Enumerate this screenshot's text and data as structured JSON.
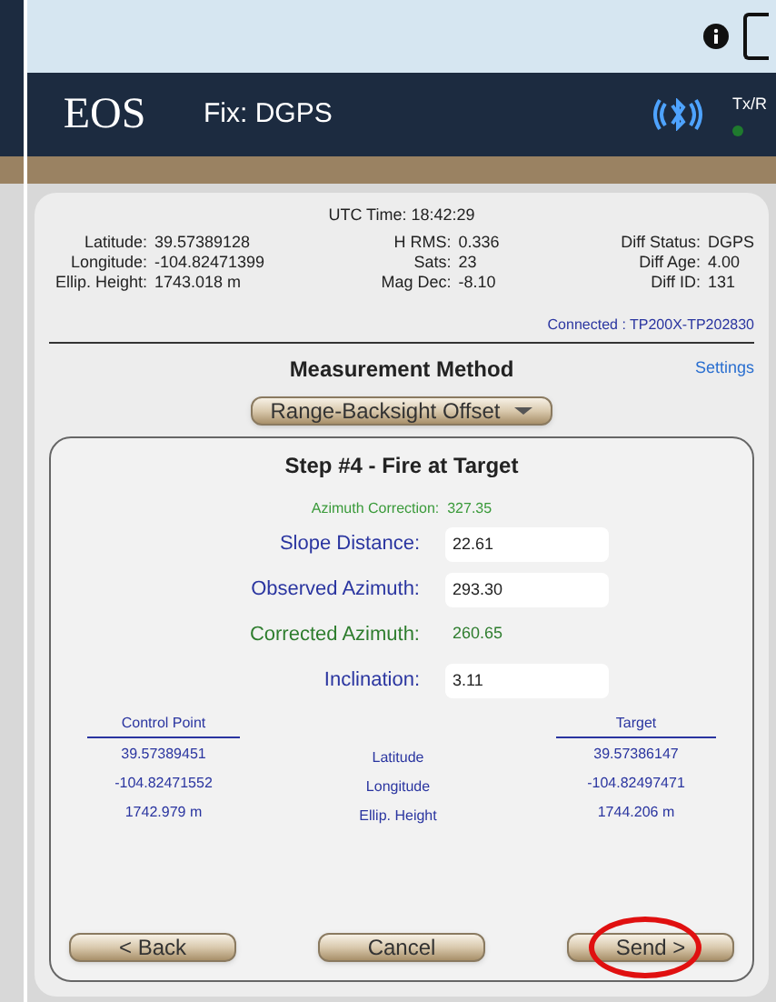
{
  "header": {
    "fix": "Fix: DGPS",
    "txrx": "Tx/R",
    "logo": "EOS"
  },
  "status": {
    "utc": "UTC Time: 18:42:29",
    "col1": [
      {
        "label": "Latitude:",
        "value": "39.57389128"
      },
      {
        "label": "Longitude:",
        "value": "-104.82471399"
      },
      {
        "label": "Ellip. Height:",
        "value": "1743.018 m"
      }
    ],
    "col2": [
      {
        "label": "H RMS:",
        "value": "0.336"
      },
      {
        "label": "Sats:",
        "value": "23"
      },
      {
        "label": "Mag Dec:",
        "value": "-8.10"
      }
    ],
    "col3": [
      {
        "label": "Diff Status:",
        "value": "DGPS"
      },
      {
        "label": "Diff Age:",
        "value": "4.00"
      },
      {
        "label": "Diff ID:",
        "value": "131"
      }
    ],
    "connected": "Connected : TP200X-TP202830"
  },
  "method": {
    "title": "Measurement Method",
    "settings": "Settings",
    "dropdown": "Range-Backsight Offset"
  },
  "step": {
    "title": "Step #4 - Fire at Target",
    "correction": "Azimuth Correction:  327.35",
    "fields": [
      {
        "label": "Slope Distance:",
        "value": "22.61",
        "kind": "input"
      },
      {
        "label": "Observed Azimuth:",
        "value": "293.30",
        "kind": "input"
      },
      {
        "label": "Corrected Azimuth:",
        "value": "260.65",
        "kind": "computed"
      },
      {
        "label": "Inclination:",
        "value": "3.11",
        "kind": "input"
      }
    ],
    "control_heading": "Control Point",
    "target_heading": "Target",
    "rows": [
      {
        "control": "39.57389451",
        "label": "Latitude",
        "target": "39.57386147"
      },
      {
        "control": "-104.82471552",
        "label": "Longitude",
        "target": "-104.82497471"
      },
      {
        "control": "1742.979 m",
        "label": "Ellip. Height",
        "target": "1744.206 m"
      }
    ],
    "buttons": [
      {
        "label": "< Back",
        "highlighted": false
      },
      {
        "label": "Cancel",
        "highlighted": false
      },
      {
        "label": "Send >",
        "highlighted": true
      }
    ]
  }
}
